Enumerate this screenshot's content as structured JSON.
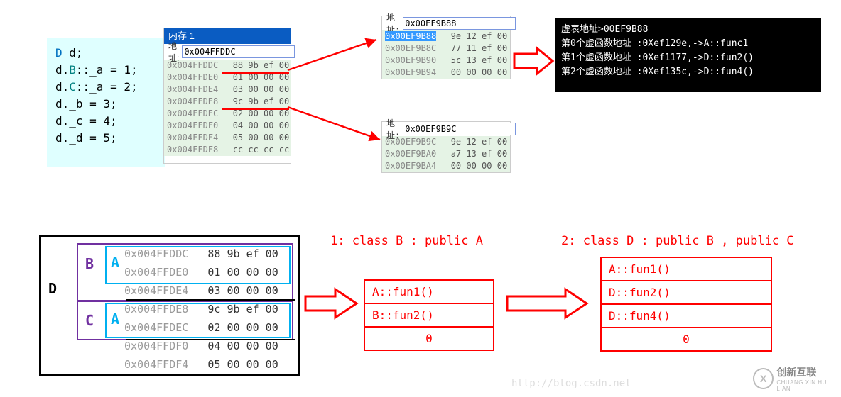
{
  "code": {
    "l1a": "D ",
    "l1b": "d;",
    "l2a": "d.",
    "l2b": "B",
    "l2c": "::_a = 1;",
    "l3a": "d.",
    "l3b": "C",
    "l3c": "::_a = 2;",
    "l4": "d._b = 3;",
    "l5": "d._c = 4;",
    "l6": "d._d = 5;"
  },
  "mem1": {
    "title": "内存 1",
    "addr_lbl": "地址:",
    "addr_val": "0x004FFDDC",
    "lines": [
      {
        "a": "0x004FFDDC",
        "b": "88 9b ef 00"
      },
      {
        "a": "0x004FFDE0",
        "b": "01 00 00 00"
      },
      {
        "a": "0x004FFDE4",
        "b": "03 00 00 00"
      },
      {
        "a": "0x004FFDE8",
        "b": "9c 9b ef 00"
      },
      {
        "a": "0x004FFDEC",
        "b": "02 00 00 00"
      },
      {
        "a": "0x004FFDF0",
        "b": "04 00 00 00"
      },
      {
        "a": "0x004FFDF4",
        "b": "05 00 00 00"
      },
      {
        "a": "0x004FFDF8",
        "b": "cc cc cc cc"
      }
    ]
  },
  "mem2": {
    "addr_lbl": "地址:",
    "addr_val": "0x00EF9B88",
    "lines": [
      {
        "a": "0x00EF9B88",
        "b": "9e 12 ef 00"
      },
      {
        "a": "0x00EF9B8C",
        "b": "77 11 ef 00"
      },
      {
        "a": "0x00EF9B90",
        "b": "5c 13 ef 00"
      },
      {
        "a": "0x00EF9B94",
        "b": "00 00 00 00"
      }
    ]
  },
  "mem3": {
    "addr_lbl": "地址:",
    "addr_val": "0x00EF9B9C",
    "lines": [
      {
        "a": "0x00EF9B9C",
        "b": "9e 12 ef 00"
      },
      {
        "a": "0x00EF9BA0",
        "b": "a7 13 ef 00"
      },
      {
        "a": "0x00EF9BA4",
        "b": "00 00 00 00"
      }
    ]
  },
  "console": {
    "l1": "虚表地址>00EF9B88",
    "l2": "第0个虚函数地址 :0Xef129e,->A::func1",
    "l3": "第1个虚函数地址 :0Xef1177,->D::fun2()",
    "l4": "第2个虚函数地址 :0Xef135c,->D::fun4()"
  },
  "diagram": {
    "D": "D",
    "B": "B",
    "C": "C",
    "A": "A",
    "rows": [
      {
        "a": "0x004FFDDC",
        "b": "88 9b ef 00"
      },
      {
        "a": "0x004FFDE0",
        "b": "01 00 00 00"
      },
      {
        "a": "0x004FFDE4",
        "b": "03 00 00 00"
      },
      {
        "a": "0x004FFDE8",
        "b": "9c 9b ef 00"
      },
      {
        "a": "0x004FFDEC",
        "b": "02 00 00 00"
      },
      {
        "a": "0x004FFDF0",
        "b": "04 00 00 00"
      },
      {
        "a": "0x004FFDF4",
        "b": "05 00 00 00"
      }
    ],
    "title1": "1: class B : public A",
    "title2": "2: class D : public B , public C",
    "vt1": {
      "r1": "A::fun1()",
      "r2": "B::fun2()",
      "r3": "0"
    },
    "vt2": {
      "r1": "A::fun1()",
      "r2": "D::fun2()",
      "r3": "D::fun4()",
      "r4": "0"
    }
  },
  "footer": {
    "url": "http://blog.csdn.net",
    "brand": "创新互联",
    "sub": "CHUANG XIN HU LIAN",
    "mark": "X"
  }
}
